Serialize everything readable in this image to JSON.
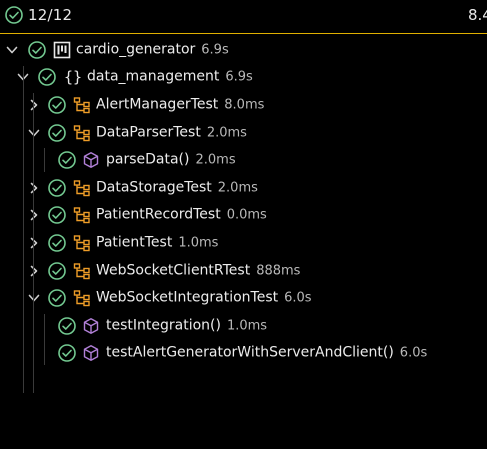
{
  "summary": {
    "count": "12/12",
    "duration": "8.4"
  },
  "colors": {
    "pass": "#73c991",
    "chevron": "#cfcfcf",
    "class_icon": "#ee9d28",
    "method_icon": "#b180d7",
    "divider": "#e0b000"
  },
  "tree": {
    "root": {
      "label": "cardio_generator",
      "time": "6.9s",
      "icon": "module-icon"
    },
    "package": {
      "label": "data_management",
      "time": "6.9s",
      "icon": "braces-icon"
    },
    "items": [
      {
        "label": "AlertManagerTest",
        "time": "8.0ms",
        "expanded": false
      },
      {
        "label": "DataParserTest",
        "time": "2.0ms",
        "expanded": true,
        "children": [
          {
            "label": "parseData()",
            "time": "2.0ms"
          }
        ]
      },
      {
        "label": "DataStorageTest",
        "time": "2.0ms",
        "expanded": false
      },
      {
        "label": "PatientRecordTest",
        "time": "0.0ms",
        "expanded": false
      },
      {
        "label": "PatientTest",
        "time": "1.0ms",
        "expanded": false
      },
      {
        "label": "WebSocketClientRTest",
        "time": "888ms",
        "expanded": false
      },
      {
        "label": "WebSocketIntegrationTest",
        "time": "6.0s",
        "expanded": true,
        "children": [
          {
            "label": "testIntegration()",
            "time": "1.0ms"
          },
          {
            "label": "testAlertGeneratorWithServerAndClient()",
            "time": "6.0s"
          }
        ]
      }
    ]
  }
}
